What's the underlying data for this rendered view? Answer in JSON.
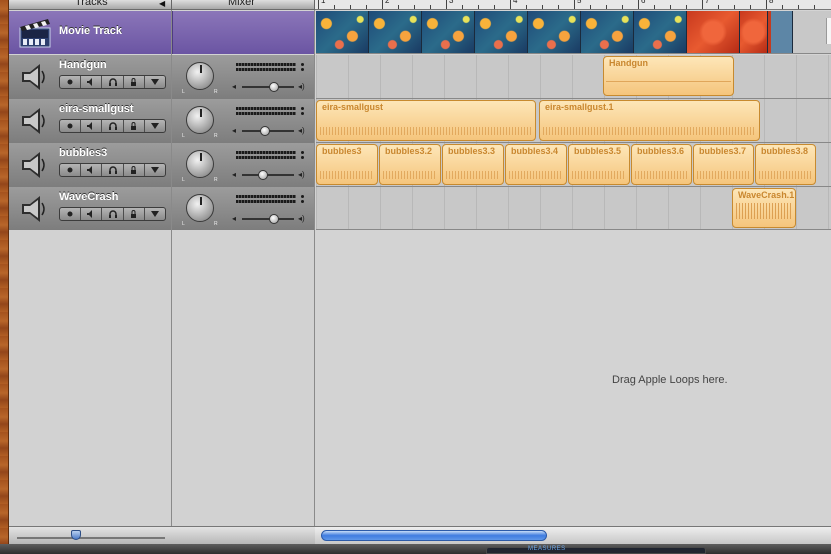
{
  "header": {
    "tracks_label": "Tracks",
    "mixer_label": "Mixer"
  },
  "ruler": {
    "markers": [
      "1",
      "2",
      "3",
      "4",
      "5",
      "6",
      "7",
      "8"
    ]
  },
  "tracks": [
    {
      "name": "Movie Track",
      "kind": "movie",
      "icon": "clapperboard-icon"
    },
    {
      "name": "Handgun",
      "kind": "audio",
      "icon": "speaker-icon",
      "volume": 0.62
    },
    {
      "name": "eira-smallgust",
      "kind": "audio",
      "icon": "speaker-icon",
      "volume": 0.45
    },
    {
      "name": "bubbles3",
      "kind": "audio",
      "icon": "speaker-icon",
      "volume": 0.4
    },
    {
      "name": "WaveCrash",
      "kind": "audio",
      "icon": "speaker-icon",
      "volume": 0.62
    }
  ],
  "track_buttons": [
    "record-enable",
    "mute",
    "solo",
    "lock",
    "expand"
  ],
  "regions": {
    "handgun": [
      "Handgun"
    ],
    "eira": [
      "eira-smallgust",
      "eira-smallgust.1"
    ],
    "bubbles": [
      "bubbles3",
      "bubbles3.2",
      "bubbles3.3",
      "bubbles3.4",
      "bubbles3.5",
      "bubbles3.6",
      "bubbles3.7",
      "bubbles3.8"
    ],
    "wavecrash": [
      "WaveCrash.1"
    ]
  },
  "drop_zone": {
    "message": "Drag Apple Loops here."
  },
  "status_bar": {
    "display_mode": "MEASURES"
  },
  "colors": {
    "movie_track": "#7c66b0",
    "region_fill": "#f8d08e",
    "region_text": "#c9872f",
    "scroll_thumb": "#3f7ce0"
  }
}
